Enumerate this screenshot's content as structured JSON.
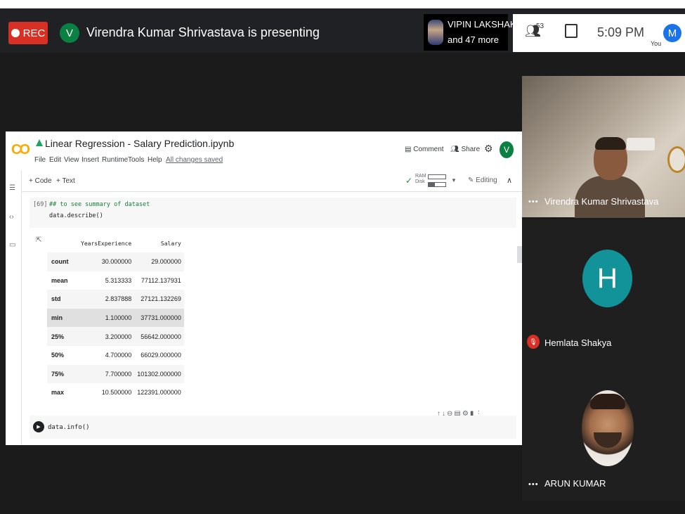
{
  "meet": {
    "rec_label": "REC",
    "presenter_initial": "V",
    "presenting_text": "Virendra Kumar Shrivastava is presenting",
    "pinned_name": "VIPIN LAKSHAK...",
    "others_text": "and 47 more",
    "participant_count": "53",
    "time": "5:09 PM",
    "you_label": "You",
    "my_initial": "M"
  },
  "colab": {
    "logo_text": "CO",
    "notebook_title": "Linear Regression - Salary Prediction.ipynb",
    "menu": [
      "File",
      "Edit",
      "View",
      "Insert",
      "Runtime",
      "Tools",
      "Help"
    ],
    "save_status": "All changes saved",
    "comment_label": "Comment",
    "share_label": "Share",
    "account_initial": "V",
    "add_code_label": "+ Code",
    "add_text_label": "+ Text",
    "ram_label": "RAM",
    "disk_label": "Disk",
    "editing_label": "Editing",
    "cell1": {
      "exec_count": "[69]",
      "comment": "## to see summary of dataset",
      "code": "data.describe()"
    },
    "describe_table": {
      "columns": [
        "YearsExperience",
        "Salary"
      ],
      "rows": [
        {
          "index": "count",
          "years": "30.000000",
          "salary": "29.000000"
        },
        {
          "index": "mean",
          "years": "5.313333",
          "salary": "77112.137931"
        },
        {
          "index": "std",
          "years": "2.837888",
          "salary": "27121.132269"
        },
        {
          "index": "min",
          "years": "1.100000",
          "salary": "37731.000000"
        },
        {
          "index": "25%",
          "years": "3.200000",
          "salary": "56642.000000"
        },
        {
          "index": "50%",
          "years": "4.700000",
          "salary": "66029.000000"
        },
        {
          "index": "75%",
          "years": "7.700000",
          "salary": "101302.000000"
        },
        {
          "index": "max",
          "years": "10.500000",
          "salary": "122391.000000"
        }
      ]
    },
    "cell2": {
      "code": "data.info()"
    }
  },
  "participants": [
    {
      "name": "Virendra Kumar Shrivastava"
    },
    {
      "name": "Hemlata Shakya",
      "initial": "H",
      "muted": true
    },
    {
      "name": "ARUN KUMAR"
    }
  ],
  "colors": {
    "rec": "#d93025",
    "presenter_avatar": "#0b8043",
    "hemlata_avatar": "#12939a",
    "my_avatar": "#1a73e8",
    "colab_orange": "#f9ab00"
  }
}
